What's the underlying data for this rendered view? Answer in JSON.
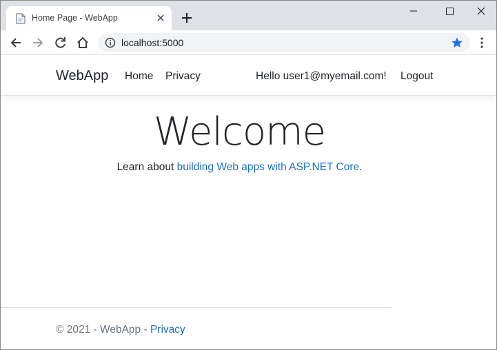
{
  "browser": {
    "tab_title": "Home Page - WebApp",
    "url": "localhost:5000",
    "icons": [
      "page-favicon-icon",
      "close-icon",
      "plus-icon",
      "minimize-icon",
      "maximize-icon",
      "close-window-icon",
      "back-arrow-icon",
      "forward-arrow-icon",
      "reload-icon",
      "home-icon",
      "info-icon",
      "star-icon",
      "more-vert-icon"
    ],
    "colors": {
      "star": "#1a73e8",
      "tabstrip": "#dee1e6"
    }
  },
  "navbar": {
    "brand": "WebApp",
    "home": "Home",
    "privacy": "Privacy",
    "hello": "Hello user1@myemail.com!",
    "logout": "Logout"
  },
  "main": {
    "heading": "Welcome",
    "learn_prefix": "Learn about ",
    "learn_link": "building Web apps with ASP.NET Core",
    "learn_suffix": "."
  },
  "footer": {
    "copyright": "© 2021 - WebApp - ",
    "privacy_link": "Privacy"
  },
  "colors": {
    "link": "#1b6ec2",
    "text": "#212529",
    "muted": "#6c757d"
  }
}
